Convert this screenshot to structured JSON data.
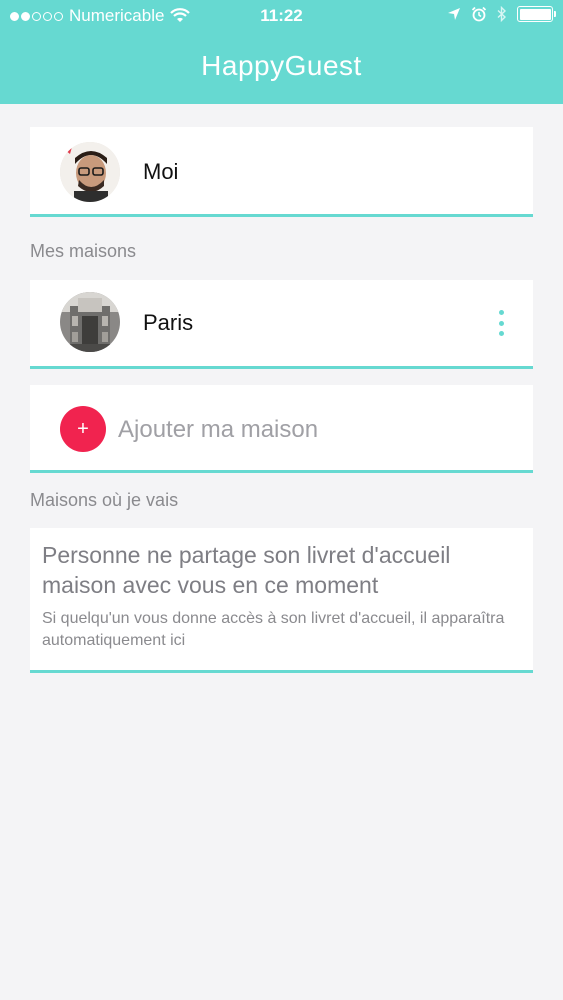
{
  "status_bar": {
    "carrier": "Numericable",
    "time": "11:22",
    "signal_dots_filled": 2,
    "signal_dots_total": 5,
    "battery_level": 1.0
  },
  "header": {
    "title": "HappyGuest"
  },
  "profile": {
    "name": "Moi"
  },
  "my_houses": {
    "section_label": "Mes maisons",
    "items": [
      {
        "name": "Paris"
      }
    ],
    "add_button_icon": "+",
    "add_label": "Ajouter ma maison"
  },
  "visiting": {
    "section_label": "Maisons où je vais",
    "empty_title": "Personne ne partage son livret d'accueil maison avec vous en ce moment",
    "empty_subtitle": "Si quelqu'un vous donne accès à son livret d'accueil, il apparaîtra automatiquement ici"
  },
  "colors": {
    "accent": "#66d9d1",
    "add_button": "#f1234f",
    "background": "#f4f4f6"
  },
  "icons": {
    "wifi": "wifi-icon",
    "location": "location-arrow-icon",
    "alarm": "alarm-clock-icon",
    "bluetooth": "bluetooth-icon",
    "battery": "battery-icon",
    "more": "more-vertical-icon",
    "add": "plus-icon"
  }
}
